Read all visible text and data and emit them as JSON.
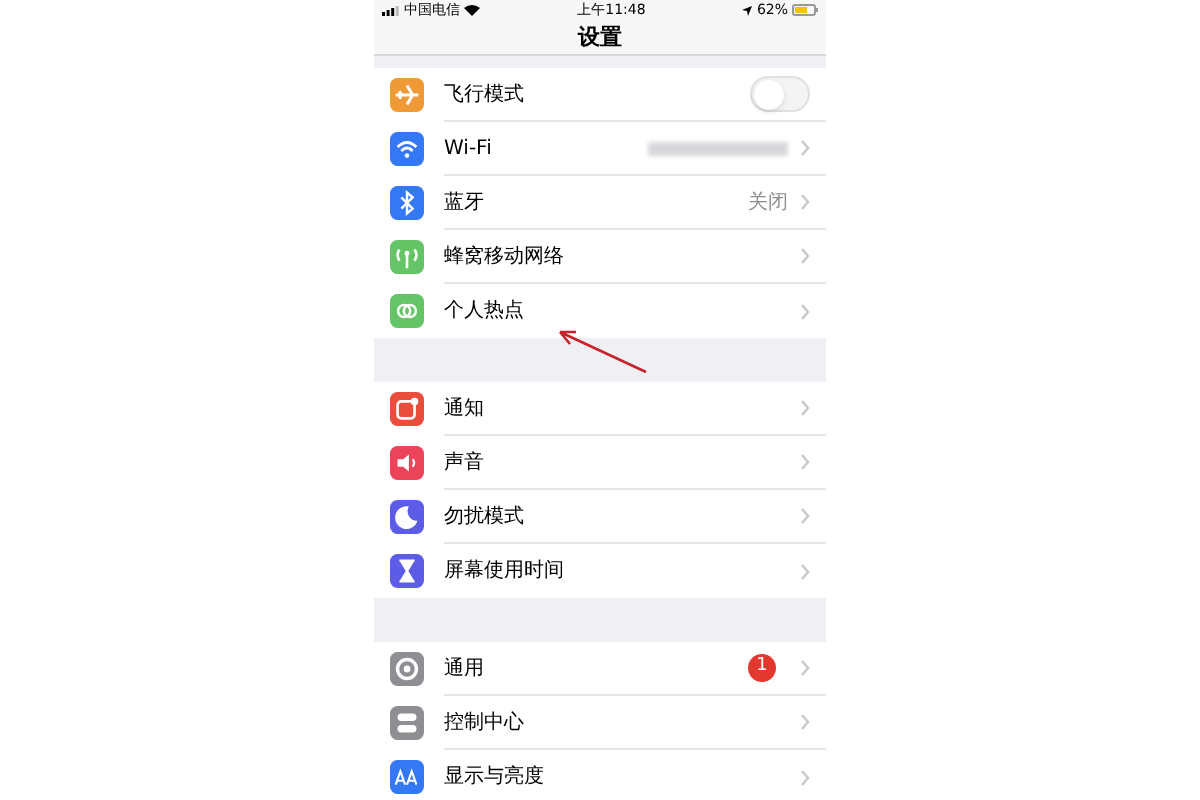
{
  "status_bar": {
    "carrier": "中国电信",
    "time": "上午11:48",
    "battery": "62%"
  },
  "title": "设置",
  "sections": [
    [
      {
        "kind": "toggle",
        "label": "飞行模式",
        "on": false,
        "color": "#f09a37"
      },
      {
        "kind": "masked",
        "label": "Wi-Fi",
        "color": "#3478f6"
      },
      {
        "kind": "link",
        "label": "蓝牙",
        "value": "关闭",
        "color": "#3478f6"
      },
      {
        "kind": "link",
        "label": "蜂窝移动网络",
        "color": "#65c466"
      },
      {
        "kind": "link",
        "label": "个人热点",
        "color": "#65c466"
      }
    ],
    [
      {
        "kind": "link",
        "label": "通知",
        "color": "#eb4d3d"
      },
      {
        "kind": "link",
        "label": "声音",
        "color": "#eb445a"
      },
      {
        "kind": "link",
        "label": "勿扰模式",
        "color": "#5d5ce6"
      },
      {
        "kind": "link",
        "label": "屏幕使用时间",
        "color": "#5d5ce6"
      }
    ],
    [
      {
        "kind": "link",
        "label": "通用",
        "badge": "1",
        "color": "#8e8e93"
      },
      {
        "kind": "link",
        "label": "控制中心",
        "color": "#8e8e93"
      },
      {
        "kind": "link",
        "label": "显示与亮度",
        "color": "#3478f6"
      }
    ]
  ]
}
